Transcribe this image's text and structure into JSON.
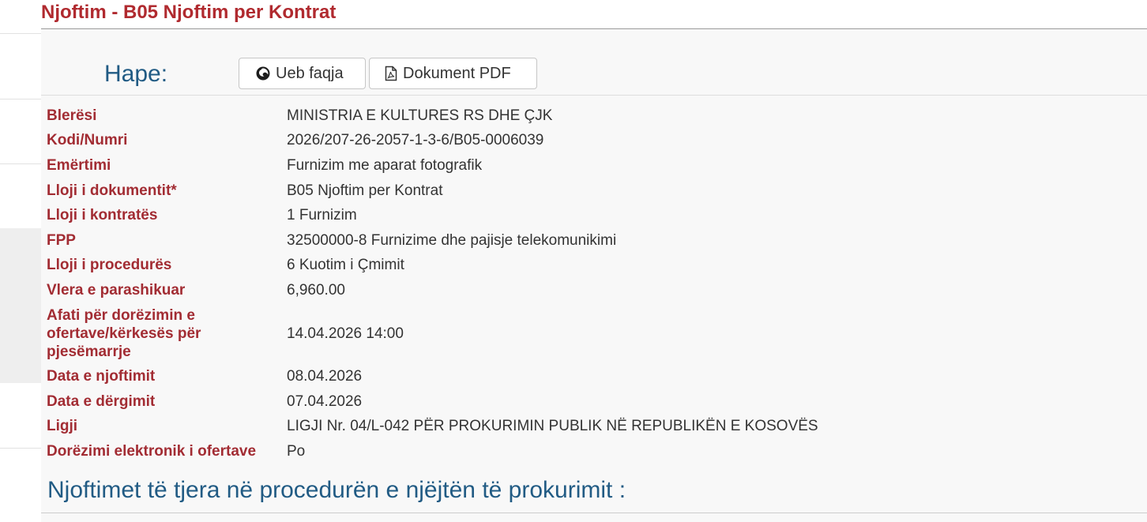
{
  "page_title": "Njoftim - B05 Njoftim per Kontrat",
  "open": {
    "label": "Hape:",
    "web_button": "Ueb faqja",
    "web_icon": "firefox-icon",
    "pdf_button": "Dokument PDF",
    "pdf_icon": "pdf-file-icon"
  },
  "details": [
    {
      "label": "Blerësi",
      "value": "MINISTRIA E KULTURES RS DHE ÇJK"
    },
    {
      "label": "Kodi/Numri",
      "value": "2026/207-26-2057-1-3-6/B05-0006039"
    },
    {
      "label": "Emërtimi",
      "value": "Furnizim me aparat fotografik"
    },
    {
      "label": "Lloji i dokumentit*",
      "value": "B05 Njoftim per Kontrat"
    },
    {
      "label": "Lloji i kontratës",
      "value": "1 Furnizim"
    },
    {
      "label": "FPP",
      "value": "32500000-8 Furnizime dhe pajisje telekomunikimi"
    },
    {
      "label": "Lloji i procedurës",
      "value": "6 Kuotim i Çmimit"
    },
    {
      "label": "Vlera e parashikuar",
      "value": "6,960.00"
    },
    {
      "label": "Afati për dorëzimin e ofertave/kërkesës për pjesëmarrje",
      "value": "14.04.2026 14:00"
    },
    {
      "label": "Data e njoftimit",
      "value": "08.04.2026"
    },
    {
      "label": "Data e dërgimit",
      "value": "07.04.2026"
    },
    {
      "label": "Ligji",
      "value": "LIGJI Nr. 04/L-042 PËR PROKURIMIN PUBLIK NË REPUBLIKËN E KOSOVËS"
    },
    {
      "label": "Dorëzimi elektronik i ofertave",
      "value": "Po"
    }
  ],
  "section_title": "Njoftimet të tjera në procedurën e njëjtën të prokurimit :",
  "colors": {
    "title_red": "#b02a2f",
    "label_red": "#a22c33",
    "heading_blue": "#215b84",
    "background": "#f8f8f8"
  }
}
